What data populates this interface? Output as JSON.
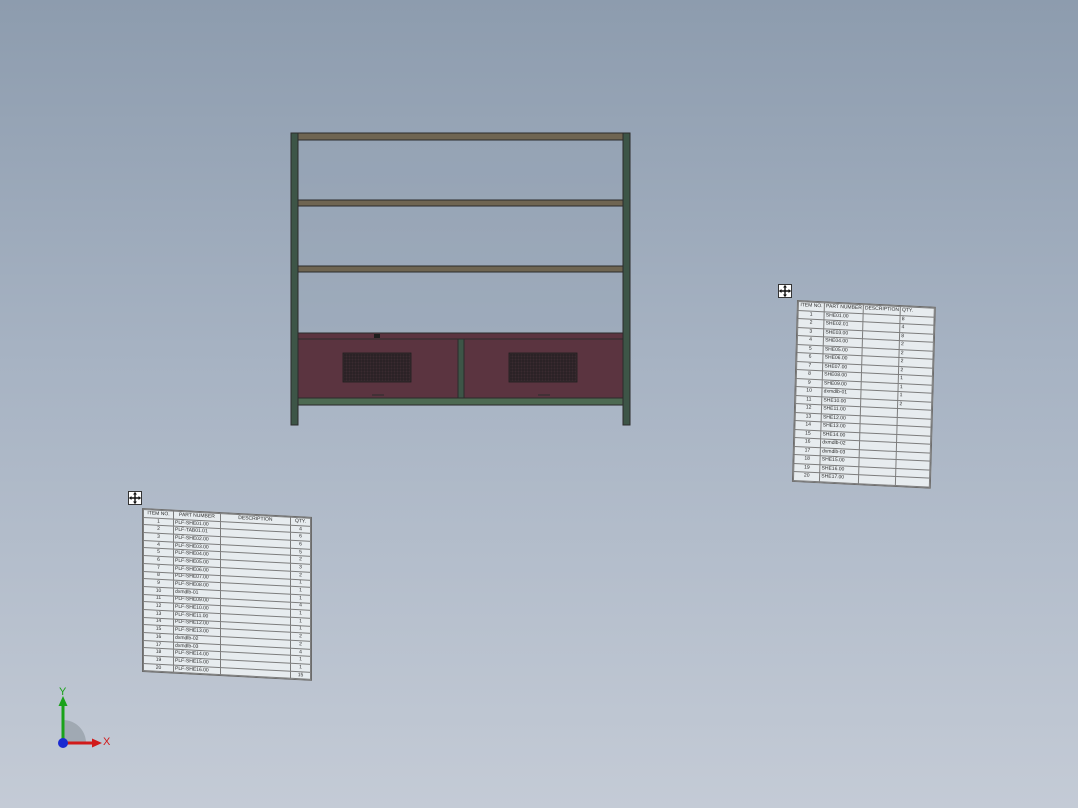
{
  "viewport": {
    "background_top": "#8d9cae",
    "background_bottom": "#c4cbd6"
  },
  "model": {
    "frame_color": "#3d5547",
    "shelf_color": "#6f6552",
    "drawer_color": "#5b3440",
    "mesh_color": "#2a2a2a"
  },
  "bom_left": {
    "handle_icon": "move-handle-icon",
    "headers": [
      "ITEM NO.",
      "PART NUMBER",
      "DESCRIPTION",
      "QTY."
    ],
    "rows": [
      [
        "1",
        "PLF-SHE01.00",
        "",
        "4"
      ],
      [
        "2",
        "PLF-TAB01.01",
        "",
        "6"
      ],
      [
        "3",
        "PLF-SHE02.00",
        "",
        "6"
      ],
      [
        "4",
        "PLF-SHE03.00",
        "",
        "5"
      ],
      [
        "5",
        "PLF-SHE04.00",
        "",
        "2"
      ],
      [
        "6",
        "PLF-SHE05.00",
        "",
        "3"
      ],
      [
        "7",
        "PLF-SHE06.00",
        "",
        "2"
      ],
      [
        "8",
        "PLF-SHE07.00",
        "",
        "1"
      ],
      [
        "9",
        "PLF-SHE08.00",
        "",
        "1"
      ],
      [
        "10",
        "dxmdlb-01",
        "",
        "1"
      ],
      [
        "11",
        "PLF-SHE09.00",
        "",
        "4"
      ],
      [
        "12",
        "PLF-SHE10.00",
        "",
        "1"
      ],
      [
        "13",
        "PLF-SHE11.00",
        "",
        "1"
      ],
      [
        "14",
        "PLF-SHE12.00",
        "",
        "1"
      ],
      [
        "15",
        "PLF-SHE13.00",
        "",
        "2"
      ],
      [
        "16",
        "dxmdlb-02",
        "",
        "2"
      ],
      [
        "17",
        "dxmdlb-03",
        "",
        "4"
      ],
      [
        "18",
        "PLF-SHE14.00",
        "",
        "1"
      ],
      [
        "19",
        "PLF-SHE15.00",
        "",
        "1"
      ],
      [
        "20",
        "PLF-SHE16.00",
        "",
        "15"
      ]
    ]
  },
  "bom_right": {
    "handle_icon": "move-handle-icon",
    "headers": [
      "ITEM NO.",
      "PART NUMBER",
      "DESCRIPTION",
      "QTY."
    ],
    "rows": [
      [
        "1",
        "SHE01.00",
        "",
        "8"
      ],
      [
        "2",
        "SHE02.01",
        "",
        "4"
      ],
      [
        "3",
        "SHE03.00",
        "",
        "8"
      ],
      [
        "4",
        "SHE04.00",
        "",
        "2"
      ],
      [
        "5",
        "SHE05.00",
        "",
        "2"
      ],
      [
        "6",
        "SHE06.00",
        "",
        "2"
      ],
      [
        "7",
        "SHE07.00",
        "",
        "2"
      ],
      [
        "8",
        "SHE08.00",
        "",
        "1"
      ],
      [
        "9",
        "SHE09.00",
        "",
        "1"
      ],
      [
        "10",
        "dxmdlb-01",
        "",
        "1"
      ],
      [
        "11",
        "SHE10.00",
        "",
        "2"
      ],
      [
        "12",
        "SHE11.00",
        "",
        ""
      ],
      [
        "13",
        "SHE12.00",
        "",
        ""
      ],
      [
        "14",
        "SHE13.00",
        "",
        ""
      ],
      [
        "15",
        "SHE14.00",
        "",
        ""
      ],
      [
        "16",
        "dxmdlb-02",
        "",
        ""
      ],
      [
        "17",
        "dxmdlb-03",
        "",
        ""
      ],
      [
        "18",
        "SHE15.00",
        "",
        ""
      ],
      [
        "19",
        "SHE16.00",
        "",
        ""
      ],
      [
        "20",
        "SHE17.00",
        "",
        ""
      ]
    ]
  },
  "triad": {
    "x_label": "X",
    "y_label": "Y",
    "x_color": "#d11a1a",
    "y_color": "#1aa21a",
    "z_color": "#1a2ad1"
  }
}
